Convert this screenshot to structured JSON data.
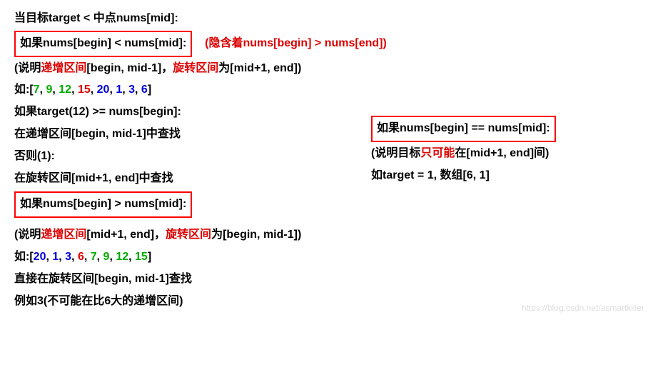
{
  "line1": "当目标target < 中点nums[mid]:",
  "box1": "如果nums[begin] < nums[mid]:",
  "implication1_pre": "(隐含着",
  "implication1_code": "nums[begin] > nums[end]",
  "implication1_post": ")",
  "desc1_a": "(说明",
  "desc1_b": "递增区间",
  "desc1_c": "[begin, mid-1]，",
  "desc1_d": "旋转区间",
  "desc1_e": "为[mid+1, end])",
  "arr1_pre": "如:[",
  "arr1_g1": "7",
  "arr1_s1": ", ",
  "arr1_g2": "9",
  "arr1_s2": ", ",
  "arr1_g3": "12",
  "arr1_s3": ", ",
  "arr1_r1": "15",
  "arr1_s4": ", ",
  "arr1_b1": "20",
  "arr1_s5": ", ",
  "arr1_b2": "1",
  "arr1_s6": ", ",
  "arr1_b3": "3",
  "arr1_s7": ", ",
  "arr1_b4": "6",
  "arr1_post": "]",
  "line_if": "如果target(12) >= nums[begin]:",
  "line_if_body": "在递增区间[begin, mid-1]中查找",
  "line_else": "否则(1):",
  "line_else_body": "在旋转区间[mid+1, end]中查找",
  "box2": "如果nums[begin] > nums[mid]:",
  "desc2_a": "(说明",
  "desc2_b": "递增区间",
  "desc2_c": "[mid+1, end]，",
  "desc2_d": "旋转区间",
  "desc2_e": "为[begin, mid-1])",
  "arr2_pre": "如:[",
  "arr2_b1": "20",
  "arr2_s1": ", ",
  "arr2_b2": "1",
  "arr2_s2": ", ",
  "arr2_b3": "3",
  "arr2_s3": ", ",
  "arr2_r1": "6",
  "arr2_s4": ", ",
  "arr2_g1": "7",
  "arr2_s5": ", ",
  "arr2_g2": "9",
  "arr2_s6": ", ",
  "arr2_g3": "12",
  "arr2_s7": ", ",
  "arr2_g4": "15",
  "arr2_post": "]",
  "line_direct": "直接在旋转区间[begin, mid-1]查找",
  "line_eg": "例如3(不可能在比6大的递增区间)",
  "side_box": "如果nums[begin] == nums[mid]:",
  "side_desc_a": "(说明目标",
  "side_desc_b": "只可能",
  "side_desc_c": "在[mid+1, end]间)",
  "side_eg": "如target = 1, 数组[6, 1]",
  "watermark": "https://blog.csdn.net/asmartkiller"
}
